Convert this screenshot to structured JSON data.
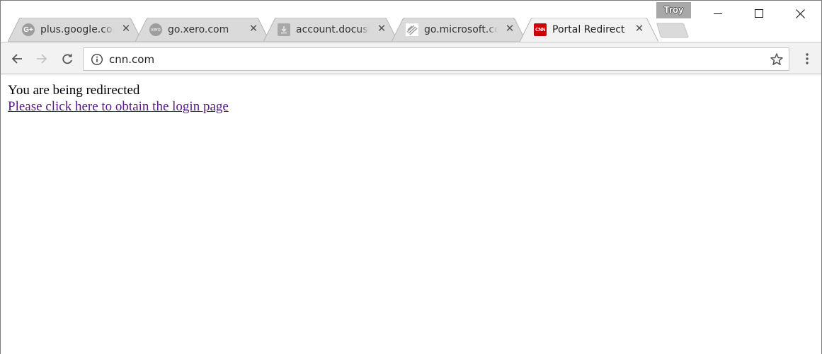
{
  "browser": {
    "profile_name": "Troy",
    "tabs": [
      {
        "title": "plus.google.com",
        "favicon": "google-plus-icon",
        "active": false
      },
      {
        "title": "go.xero.com",
        "favicon": "xero-icon",
        "active": false
      },
      {
        "title": "account.docusign.com",
        "favicon": "download-icon",
        "active": false
      },
      {
        "title": "go.microsoft.com",
        "favicon": "microsoft-page-icon",
        "active": false
      },
      {
        "title": "Portal Redirect",
        "favicon": "cnn-icon",
        "active": true
      }
    ],
    "favicon_labels": {
      "google_plus": "G+",
      "xero": "xero",
      "cnn": "CNN"
    },
    "address_bar": {
      "url": "cnn.com"
    },
    "colors": {
      "cnn_red": "#cc0000",
      "tab_inactive": "#dadada",
      "visited_link": "#551a8b"
    }
  },
  "page": {
    "message": "You are being redirected",
    "link_text": "Please click here to obtain the login page"
  }
}
